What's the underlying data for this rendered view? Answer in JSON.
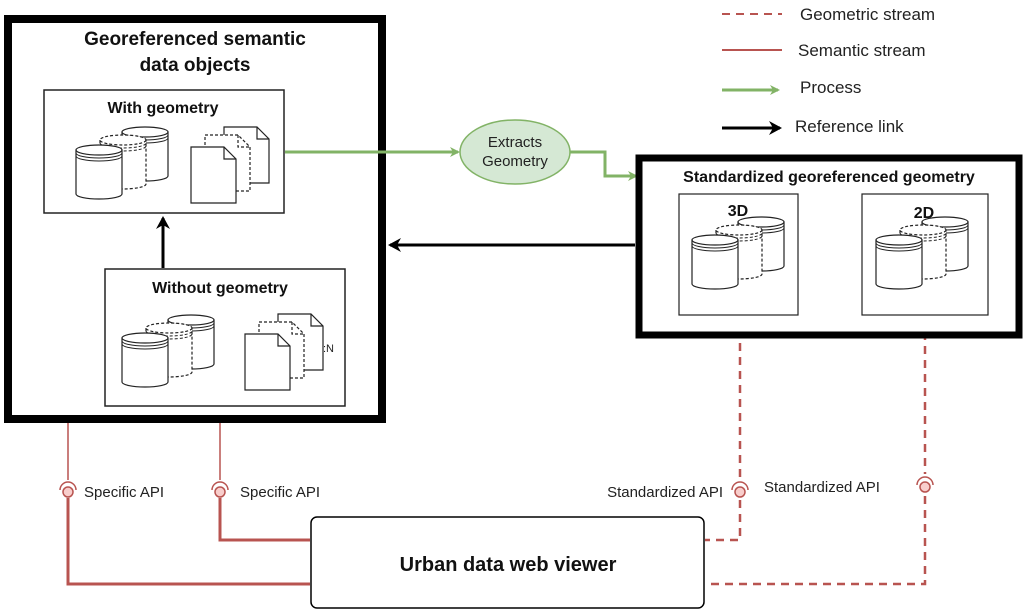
{
  "legend": {
    "geometric_stream": "Geometric stream",
    "semantic_stream": "Semantic stream",
    "process": "Process",
    "reference_link": "Reference link"
  },
  "semantic_box": {
    "title_line1": "Georeferenced semantic",
    "title_line2": "data objects",
    "with_geometry": "With geometry",
    "without_geometry": "Without  geometry",
    "cardinality": ":N"
  },
  "process": {
    "line1": "Extracts",
    "line2": "Geometry"
  },
  "geometry_box": {
    "title": "Standardized georeferenced geometry",
    "box_3d": "3D",
    "box_2d": "2D"
  },
  "apis": {
    "specific_1": "Specific API",
    "specific_2": "Specific API",
    "standardized_1": "Standardized API",
    "standardized_2": "Standardized API"
  },
  "viewer": {
    "label": "Urban data web viewer"
  },
  "colors": {
    "semantic": "#b85450",
    "process": "#82b366",
    "process_fill": "#d5e8d4",
    "socket_fill": "#f8cecc",
    "reference": "#000000"
  }
}
